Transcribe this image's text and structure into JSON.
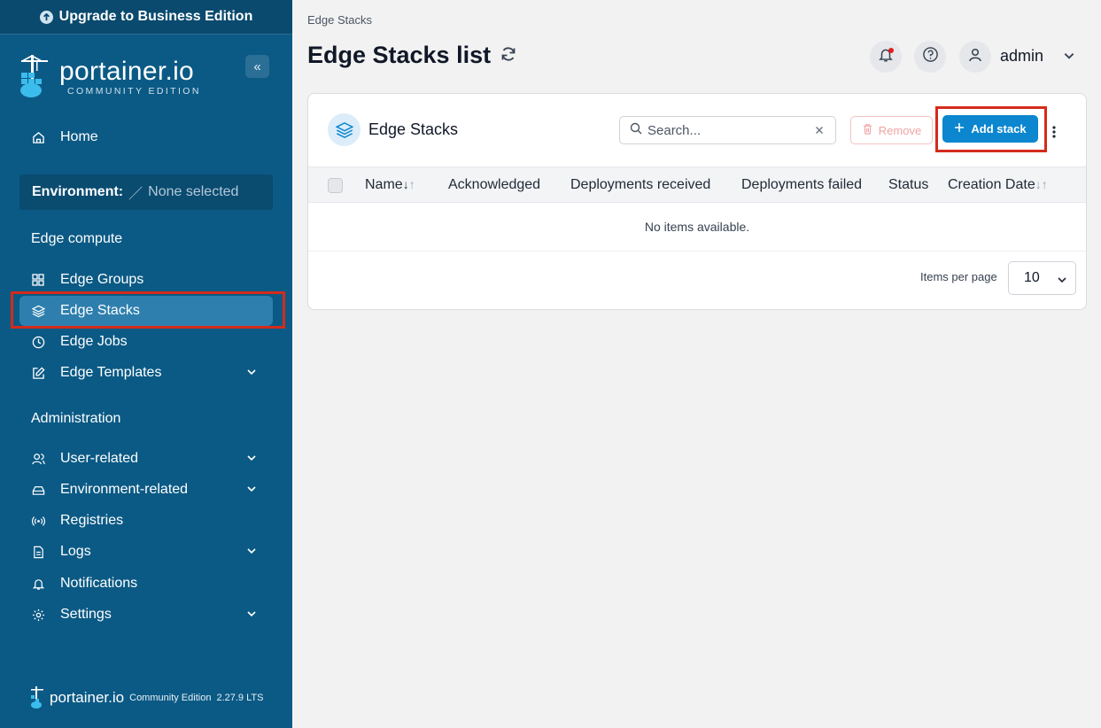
{
  "upgrade_banner": "Upgrade to Business Edition",
  "logo": {
    "name": "portainer.io",
    "edition": "COMMUNITY EDITION"
  },
  "sidebar": {
    "home": "Home",
    "environment_label": "Environment:",
    "environment_value": "None selected",
    "section_edge": "Edge compute",
    "edge_items": [
      {
        "label": "Edge Groups",
        "icon": "grid-icon"
      },
      {
        "label": "Edge Stacks",
        "icon": "layers-icon",
        "active": true
      },
      {
        "label": "Edge Jobs",
        "icon": "clock-icon"
      },
      {
        "label": "Edge Templates",
        "icon": "edit-icon",
        "expandable": true
      }
    ],
    "section_admin": "Administration",
    "admin_items": [
      {
        "label": "User-related",
        "icon": "users-icon",
        "expandable": true
      },
      {
        "label": "Environment-related",
        "icon": "hard-drive-icon",
        "expandable": true
      },
      {
        "label": "Registries",
        "icon": "radio-icon"
      },
      {
        "label": "Logs",
        "icon": "file-icon",
        "expandable": true
      },
      {
        "label": "Notifications",
        "icon": "bell-icon"
      },
      {
        "label": "Settings",
        "icon": "gear-icon",
        "expandable": true
      }
    ],
    "footer_brand": "portainer.io",
    "footer_edition": "Community Edition",
    "footer_version": "2.27.9 LTS"
  },
  "breadcrumb": "Edge Stacks",
  "page_title": "Edge Stacks list",
  "user": {
    "name": "admin"
  },
  "card": {
    "title": "Edge Stacks",
    "search_placeholder": "Search...",
    "remove_label": "Remove",
    "add_label": "Add stack",
    "columns": [
      "Name",
      "Acknowledged",
      "Deployments received",
      "Deployments failed",
      "Status",
      "Creation Date"
    ],
    "empty_text": "No items available.",
    "items_per_page_label": "Items per page",
    "items_per_page_value": "10"
  },
  "colors": {
    "sidebar": "#0b5a85",
    "accent": "#0b86cf",
    "highlight": "#d42b1c"
  }
}
